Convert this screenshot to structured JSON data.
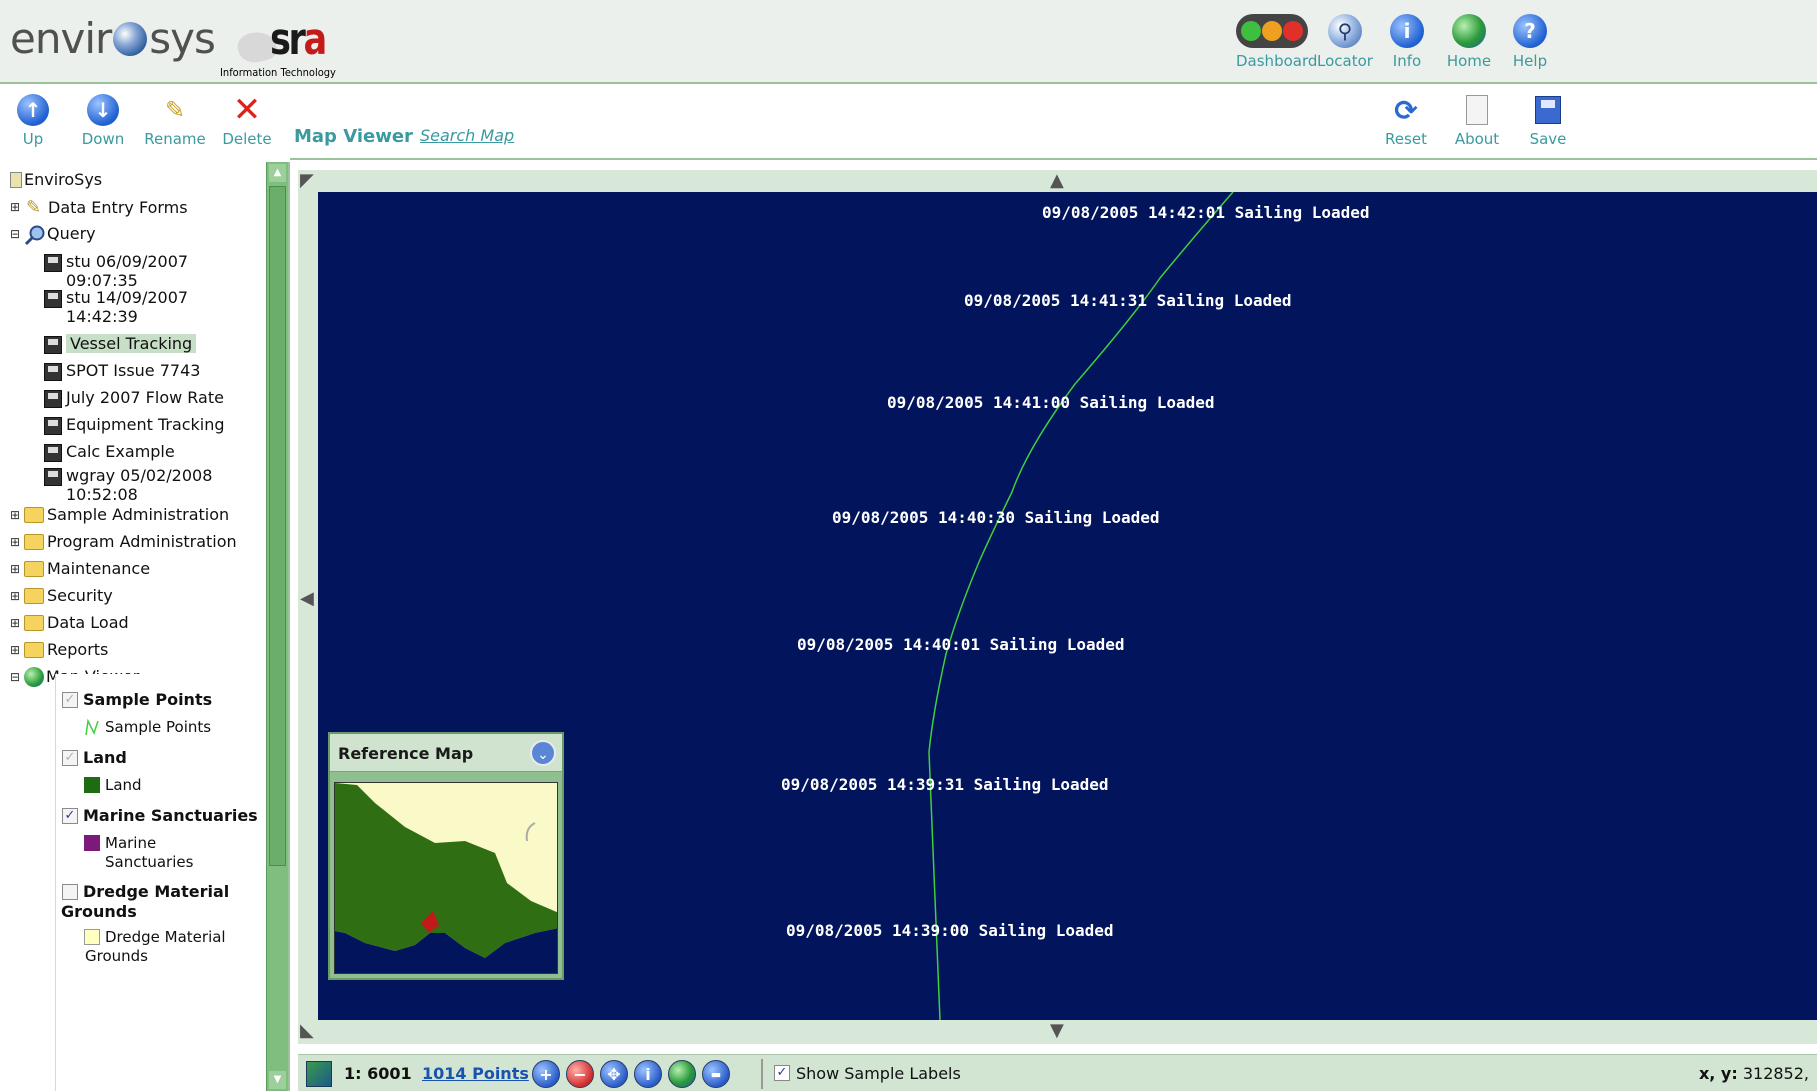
{
  "header": {
    "logo_left": "envir",
    "logo_right": "sys",
    "sra_logo": {
      "text_main": "sr",
      "text_accent": "a",
      "subtitle": "Information Technology"
    },
    "buttons": [
      {
        "id": "dashboard",
        "label": "Dashboard",
        "icon": "traffic-light-icon"
      },
      {
        "id": "locator",
        "label": "Locator",
        "icon": "magnifier-icon"
      },
      {
        "id": "info",
        "label": "Info",
        "icon": "info-icon"
      },
      {
        "id": "home",
        "label": "Home",
        "icon": "globe-icon"
      },
      {
        "id": "help",
        "label": "Help",
        "icon": "help-icon"
      }
    ]
  },
  "toolbar": {
    "up_label": "Up",
    "down_label": "Down",
    "rename_label": "Rename",
    "delete_label": "Delete",
    "title": "Map Viewer",
    "search_link": "Search Map",
    "reset_label": "Reset",
    "about_label": "About",
    "save_label": "Save"
  },
  "tree": {
    "root": "EnviroSys",
    "data_entry": "Data Entry Forms",
    "query": "Query",
    "queries": [
      {
        "line1": "stu 06/09/2007",
        "line2": "09:07:35"
      },
      {
        "line1": "stu 14/09/2007",
        "line2": "14:42:39"
      },
      {
        "line1": "Vessel Tracking",
        "line2": ""
      },
      {
        "line1": "SPOT Issue 7743",
        "line2": ""
      },
      {
        "line1": "July 2007 Flow Rate",
        "line2": ""
      },
      {
        "line1": "Equipment Tracking",
        "line2": ""
      },
      {
        "line1": "Calc Example",
        "line2": ""
      },
      {
        "line1": "wgray 05/02/2008",
        "line2": "10:52:08"
      }
    ],
    "folders": [
      "Sample Administration",
      "Program Administration",
      "Maintenance",
      "Security",
      "Data Load",
      "Reports"
    ],
    "map_viewer": "Map Viewer",
    "selected": "Vessel Tracking",
    "expand_glyph": "⊞",
    "collapse_glyph": "⊟"
  },
  "legend": {
    "layers": [
      {
        "name": "Sample Points",
        "checked": true,
        "enabled": false,
        "item": "Sample Points",
        "item_line2": "",
        "swatch": "line",
        "color": "#3fcf3f"
      },
      {
        "name": "Land",
        "checked": true,
        "enabled": false,
        "item": "Land",
        "item_line2": "",
        "swatch": "fill",
        "color": "#1e6b12"
      },
      {
        "name": "Marine Sanctuaries",
        "checked": true,
        "enabled": true,
        "item": "Marine",
        "item_line2": "Sanctuaries",
        "swatch": "fill",
        "color": "#7a1a7a"
      },
      {
        "name_line1": "Dredge Material",
        "name_line2": "Grounds",
        "checked": false,
        "enabled": true,
        "item": "Dredge Material",
        "item_line2": "Grounds",
        "swatch": "fill",
        "color": "#ffffc0"
      }
    ]
  },
  "map": {
    "background": "#02145b",
    "track_color": "#3fcf3f",
    "labels": [
      "09/08/2005 14:42:01 Sailing Loaded",
      "09/08/2005 14:41:31 Sailing Loaded",
      "09/08/2005 14:41:00 Sailing Loaded",
      "09/08/2005 14:40:30 Sailing Loaded",
      "09/08/2005 14:40:01 Sailing Loaded",
      "09/08/2005 14:39:31 Sailing Loaded",
      "09/08/2005 14:39:00 Sailing Loaded"
    ],
    "reference_map": {
      "title": "Reference Map",
      "land_color": "#2f6e12",
      "sea_color": "#02145b",
      "other_color": "#fafac8"
    }
  },
  "statusbar": {
    "scale": "1: 6001",
    "points": "1014 Points",
    "tools": [
      "zoom-in-icon",
      "zoom-out-icon",
      "pan-icon",
      "identify-icon",
      "full-extent-icon",
      "measure-icon"
    ],
    "show_labels_text": "Show Sample Labels",
    "show_labels_checked": true,
    "coords_label": "x, y:",
    "coords_value": "312852,"
  }
}
